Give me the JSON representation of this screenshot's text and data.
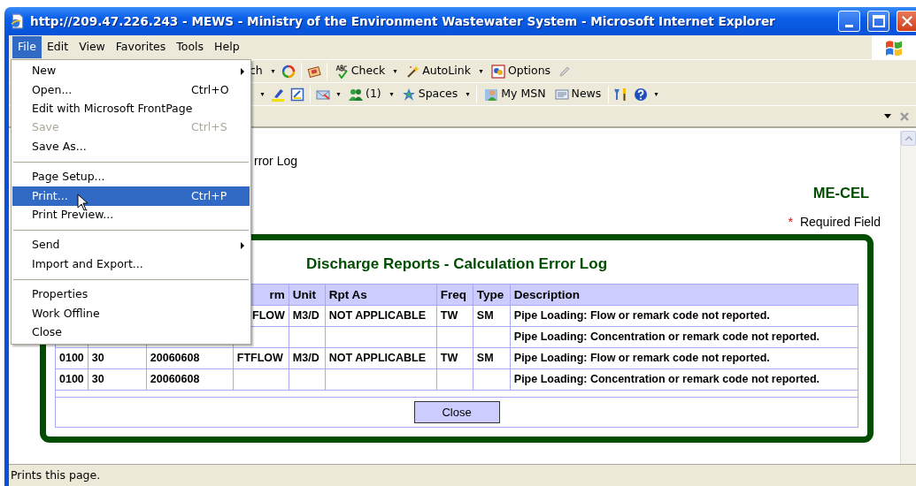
{
  "window": {
    "title": "http://209.47.226.243 - MEWS - Ministry of the Environment Wastewater System - Microsoft Internet Explorer"
  },
  "menu_bar": [
    {
      "label": "File",
      "selected": true
    },
    {
      "label": "Edit",
      "selected": false
    },
    {
      "label": "View",
      "selected": false
    },
    {
      "label": "Favorites",
      "selected": false
    },
    {
      "label": "Tools",
      "selected": false
    },
    {
      "label": "Help",
      "selected": false
    }
  ],
  "file_menu": [
    {
      "kind": "item",
      "label": "New",
      "submenu": true,
      "disabled": false,
      "selected": false
    },
    {
      "kind": "item",
      "label": "Open...",
      "shortcut": "Ctrl+O",
      "submenu": false,
      "disabled": false,
      "selected": false
    },
    {
      "kind": "item",
      "label": "Edit with Microsoft FrontPage",
      "submenu": false,
      "disabled": false,
      "selected": false
    },
    {
      "kind": "item",
      "label": "Save",
      "shortcut": "Ctrl+S",
      "submenu": false,
      "disabled": true,
      "selected": false
    },
    {
      "kind": "item",
      "label": "Save As...",
      "submenu": false,
      "disabled": false,
      "selected": false
    },
    {
      "kind": "separator"
    },
    {
      "kind": "item",
      "label": "Page Setup...",
      "submenu": false,
      "disabled": false,
      "selected": false
    },
    {
      "kind": "item",
      "label": "Print...",
      "shortcut": "Ctrl+P",
      "submenu": false,
      "disabled": false,
      "selected": true
    },
    {
      "kind": "item",
      "label": "Print Preview...",
      "submenu": false,
      "disabled": false,
      "selected": false
    },
    {
      "kind": "separator"
    },
    {
      "kind": "item",
      "label": "Send",
      "submenu": true,
      "disabled": false,
      "selected": false
    },
    {
      "kind": "item",
      "label": "Import and Export...",
      "submenu": false,
      "disabled": false,
      "selected": false
    },
    {
      "kind": "separator"
    },
    {
      "kind": "item",
      "label": "Properties",
      "submenu": false,
      "disabled": false,
      "selected": false
    },
    {
      "kind": "item",
      "label": "Work Offline",
      "submenu": false,
      "disabled": false,
      "selected": false
    },
    {
      "kind": "item",
      "label": "Close",
      "submenu": false,
      "disabled": false,
      "selected": false
    }
  ],
  "toolbars": [
    {
      "items": [
        {
          "kind": "text",
          "label": "ch"
        },
        {
          "kind": "dropdown"
        },
        {
          "kind": "icon"
        },
        {
          "kind": "separator"
        },
        {
          "kind": "icon"
        },
        {
          "kind": "separator"
        },
        {
          "kind": "button",
          "label": "Check"
        },
        {
          "kind": "dropdown"
        },
        {
          "kind": "button",
          "label": "AutoLink"
        },
        {
          "kind": "dropdown"
        },
        {
          "kind": "button",
          "label": "Options"
        },
        {
          "kind": "icon"
        }
      ]
    },
    {
      "items": [
        {
          "kind": "dropdown"
        },
        {
          "kind": "icon"
        },
        {
          "kind": "icon"
        },
        {
          "kind": "separator"
        },
        {
          "kind": "icon"
        },
        {
          "kind": "dropdown"
        },
        {
          "kind": "button",
          "label": "(1)"
        },
        {
          "kind": "dropdown"
        },
        {
          "kind": "button",
          "label": "Spaces"
        },
        {
          "kind": "dropdown"
        },
        {
          "kind": "separator"
        },
        {
          "kind": "button",
          "label": "My MSN"
        },
        {
          "kind": "button",
          "label": "News"
        },
        {
          "kind": "separator"
        },
        {
          "kind": "icon"
        },
        {
          "kind": "icon"
        },
        {
          "kind": "dropdown"
        }
      ]
    }
  ],
  "page": {
    "heading_fragment": "rror Log",
    "code": "ME-CEL",
    "required_mark": "*",
    "required_note": "Required Field",
    "panel_title": "Discharge Reports - Calculation Error Log",
    "columns": [
      "rm",
      "Unit",
      "Rpt As",
      "Freq",
      "Type",
      "Description"
    ],
    "rows": [
      {
        "column_4": "FLOW",
        "unit": "M3/D",
        "rpt_as": "NOT APPLICABLE",
        "freq": "TW",
        "type": "SM",
        "description": "Pipe Loading: Flow or remark code not reported."
      },
      {
        "description": "Pipe Loading: Concentration or remark code not reported."
      },
      {
        "column_1": "0100",
        "column_2": "30",
        "column_3": "20060608",
        "column_4": "FTFLOW",
        "unit": "M3/D",
        "rpt_as": "NOT APPLICABLE",
        "freq": "TW",
        "type": "SM",
        "description": "Pipe Loading: Flow or remark code not reported."
      },
      {
        "column_1": "0100",
        "column_2": "30",
        "column_3": "20060608",
        "description": "Pipe Loading: Concentration or remark code not reported."
      }
    ],
    "close_button": "Close"
  },
  "status_bar": {
    "text": "Prints this page."
  }
}
